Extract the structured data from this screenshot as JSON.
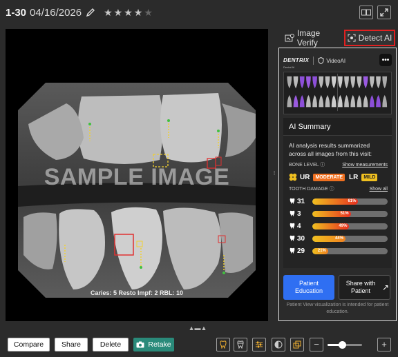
{
  "header": {
    "visit_id": "1-30",
    "date": "04/16/2026",
    "rating": 4,
    "rating_max": 5,
    "star_color": "#c8c8c8"
  },
  "viewer": {
    "watermark": "SAMPLE IMAGE",
    "findings_summary": "Caries: 5  Resto Impf: 2  RBL: 10"
  },
  "tabs": [
    {
      "label": "Image Verify",
      "icon": "image-check-icon"
    },
    {
      "label": "Detect AI",
      "icon": "ai-scan-icon",
      "active": true
    }
  ],
  "panel": {
    "brand": "DENTRIX",
    "brand_sub": "Dental AI",
    "product": "VideoAI",
    "ai_summary": {
      "title": "AI Summary",
      "description": "AI analysis results summarized across all images from this visit:",
      "bone_level_label": "BONE LEVEL",
      "show_measurements": "Show measurements",
      "bone": [
        {
          "arch": "UR",
          "severity": "MODERATE",
          "color": "#f07020"
        },
        {
          "arch": "LR",
          "severity": "MILD",
          "color": "#f0c020"
        }
      ],
      "tooth_damage_label": "TOOTH DAMAGE",
      "show_all": "Show all",
      "damage": [
        {
          "tooth": "31",
          "percent": 61,
          "label": "61%"
        },
        {
          "tooth": "3",
          "percent": 51,
          "label": "51%"
        },
        {
          "tooth": "4",
          "percent": 49,
          "label": "49%"
        },
        {
          "tooth": "30",
          "percent": 44,
          "label": "44%"
        },
        {
          "tooth": "29",
          "percent": 21,
          "label": "21%"
        }
      ]
    },
    "patient_education": "Patient Education",
    "share_with_patient": "Share with Patient",
    "footnote": "Patient View visualization is intended for patient education."
  },
  "toolbar": {
    "compare": "Compare",
    "share": "Share",
    "delete": "Delete",
    "retake": "Retake",
    "zoom_level": 0.42,
    "accent": "#2a8a7a"
  }
}
